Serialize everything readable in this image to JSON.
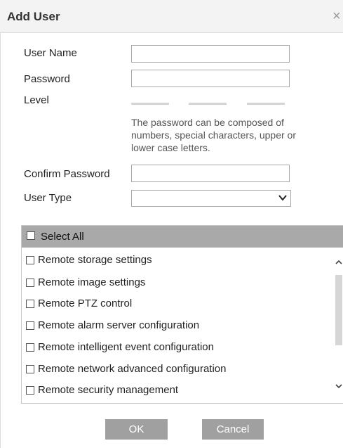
{
  "dialog": {
    "title": "Add User",
    "close_symbol": "×"
  },
  "form": {
    "user_name_label": "User Name",
    "user_name_value": "",
    "password_label": "Password",
    "password_value": "",
    "level_label": "Level",
    "password_hint": "The password can be composed of numbers, special characters, upper or lower case letters.",
    "confirm_password_label": "Confirm Password",
    "confirm_password_value": "",
    "user_type_label": "User Type",
    "user_type_value": ""
  },
  "permissions": {
    "select_all_label": "Select All",
    "select_all_checked": false,
    "items": [
      {
        "label": "Remote storage settings",
        "checked": false
      },
      {
        "label": "Remote image settings",
        "checked": false
      },
      {
        "label": "Remote PTZ control",
        "checked": false
      },
      {
        "label": "Remote alarm server configuration",
        "checked": false
      },
      {
        "label": "Remote intelligent event configuration",
        "checked": false
      },
      {
        "label": "Remote network advanced configuration",
        "checked": false
      },
      {
        "label": "Remote security management",
        "checked": false
      }
    ]
  },
  "buttons": {
    "ok_label": "OK",
    "cancel_label": "Cancel"
  },
  "colors": {
    "header_gray": "#a9a9a9",
    "button_gray": "#a0a0a0",
    "strength_bar": "#d4d4d4"
  },
  "icons": {
    "close": "close-icon",
    "select_chevron": "chevron-down-icon",
    "scroll_up": "chevron-up-icon",
    "scroll_down": "chevron-down-icon"
  }
}
